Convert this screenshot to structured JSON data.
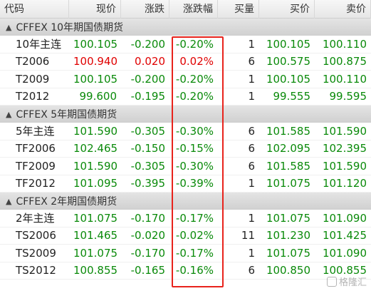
{
  "columns": {
    "code": "代码",
    "price": "现价",
    "change": "涨跌",
    "pct": "涨跌幅",
    "volume": "买量",
    "bid": "买价",
    "ask": "卖价"
  },
  "groups": [
    {
      "title": "CFFEX 10年期国债期货",
      "rows": [
        {
          "code": "10年主连",
          "price": "100.105",
          "change": "-0.200",
          "pct": "-0.20%",
          "volume": "1",
          "bid": "100.105",
          "ask": "100.110",
          "dir": "down"
        },
        {
          "code": "T2006",
          "price": "100.940",
          "change": "0.020",
          "pct": "0.02%",
          "volume": "6",
          "bid": "100.575",
          "ask": "100.875",
          "dir": "up"
        },
        {
          "code": "T2009",
          "price": "100.105",
          "change": "-0.200",
          "pct": "-0.20%",
          "volume": "1",
          "bid": "100.105",
          "ask": "100.110",
          "dir": "down"
        },
        {
          "code": "T2012",
          "price": "99.600",
          "change": "-0.195",
          "pct": "-0.20%",
          "volume": "1",
          "bid": "99.555",
          "ask": "99.595",
          "dir": "down"
        }
      ]
    },
    {
      "title": "CFFEX 5年期国债期货",
      "rows": [
        {
          "code": "5年主连",
          "price": "101.590",
          "change": "-0.305",
          "pct": "-0.30%",
          "volume": "6",
          "bid": "101.585",
          "ask": "101.590",
          "dir": "down"
        },
        {
          "code": "TF2006",
          "price": "102.465",
          "change": "-0.150",
          "pct": "-0.15%",
          "volume": "6",
          "bid": "102.095",
          "ask": "102.395",
          "dir": "down"
        },
        {
          "code": "TF2009",
          "price": "101.590",
          "change": "-0.305",
          "pct": "-0.30%",
          "volume": "6",
          "bid": "101.585",
          "ask": "101.590",
          "dir": "down"
        },
        {
          "code": "TF2012",
          "price": "101.095",
          "change": "-0.395",
          "pct": "-0.39%",
          "volume": "1",
          "bid": "101.075",
          "ask": "101.120",
          "dir": "down"
        }
      ]
    },
    {
      "title": "CFFEX 2年期国债期货",
      "rows": [
        {
          "code": "2年主连",
          "price": "101.075",
          "change": "-0.170",
          "pct": "-0.17%",
          "volume": "1",
          "bid": "101.075",
          "ask": "101.090",
          "dir": "down"
        },
        {
          "code": "TS2006",
          "price": "101.465",
          "change": "-0.020",
          "pct": "-0.02%",
          "volume": "11",
          "bid": "101.230",
          "ask": "101.425",
          "dir": "down"
        },
        {
          "code": "TS2009",
          "price": "101.075",
          "change": "-0.170",
          "pct": "-0.17%",
          "volume": "1",
          "bid": "101.075",
          "ask": "101.090",
          "dir": "down"
        },
        {
          "code": "TS2012",
          "price": "100.855",
          "change": "-0.165",
          "pct": "-0.16%",
          "volume": "6",
          "bid": "100.850",
          "ask": "100.855",
          "dir": "down"
        }
      ]
    }
  ],
  "colors": {
    "up": "#e00000",
    "down": "#0a8a0a",
    "highlight": "#e8231c"
  },
  "watermark": "格隆汇"
}
